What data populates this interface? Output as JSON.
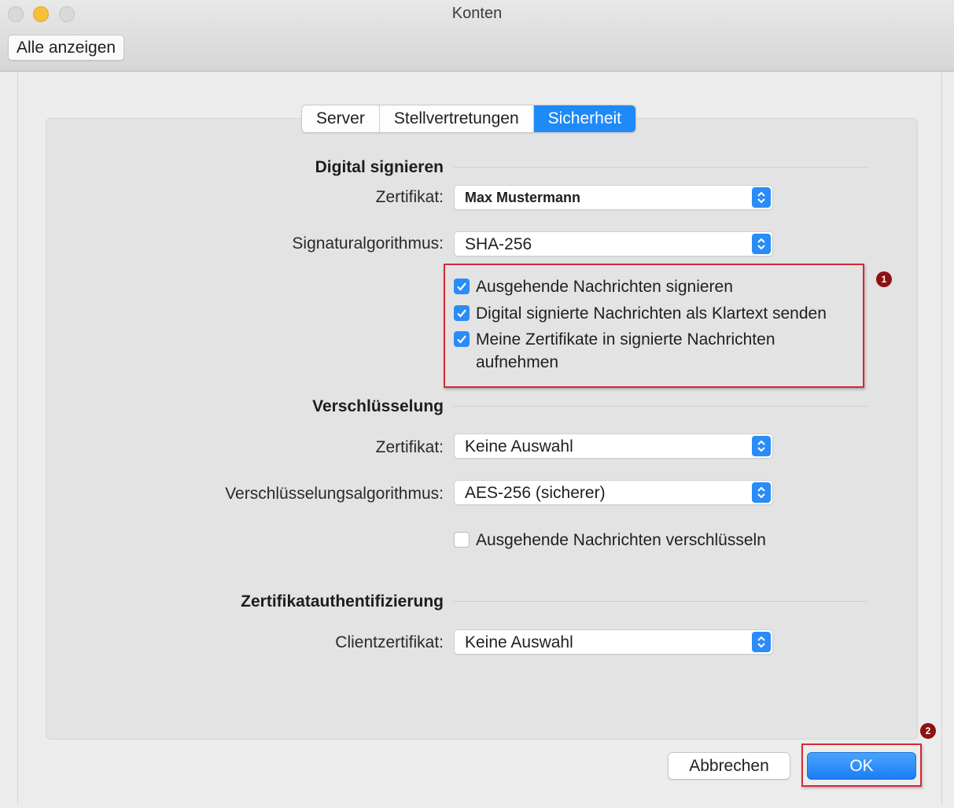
{
  "window": {
    "title": "Konten",
    "show_all_label": "Alle anzeigen"
  },
  "tabs": [
    {
      "label": "Server",
      "active": false
    },
    {
      "label": "Stellvertretungen",
      "active": false
    },
    {
      "label": "Sicherheit",
      "active": true
    }
  ],
  "signing": {
    "section_title": "Digital signieren",
    "certificate_label": "Zertifikat:",
    "certificate_value": "Max Mustermann",
    "algorithm_label": "Signaturalgorithmus:",
    "algorithm_value": "SHA-256",
    "options": [
      {
        "label": "Ausgehende Nachrichten signieren",
        "checked": true
      },
      {
        "label": "Digital signierte Nachrichten als Klartext senden",
        "checked": true
      },
      {
        "label": "Meine Zertifikate in signierte Nachrichten",
        "label_cont": "aufnehmen",
        "checked": true
      }
    ]
  },
  "encryption": {
    "section_title": "Verschlüsselung",
    "certificate_label": "Zertifikat:",
    "certificate_value": "Keine Auswahl",
    "algorithm_label": "Verschlüsselungsalgorithmus:",
    "algorithm_value": "AES-256 (sicherer)",
    "encrypt_outgoing_label": "Ausgehende Nachrichten verschlüsseln",
    "encrypt_outgoing_checked": false
  },
  "authentication": {
    "section_title": "Zertifikatauthentifizierung",
    "client_certificate_label": "Clientzertifikat:",
    "client_certificate_value": "Keine Auswahl"
  },
  "buttons": {
    "cancel_label": "Abbrechen",
    "ok_label": "OK"
  },
  "annotations": {
    "badge_1": "1",
    "badge_2": "2",
    "highlight_color": "#d12b35",
    "badge_color": "#8c1212"
  },
  "colors": {
    "accent": "#1e8af7"
  }
}
